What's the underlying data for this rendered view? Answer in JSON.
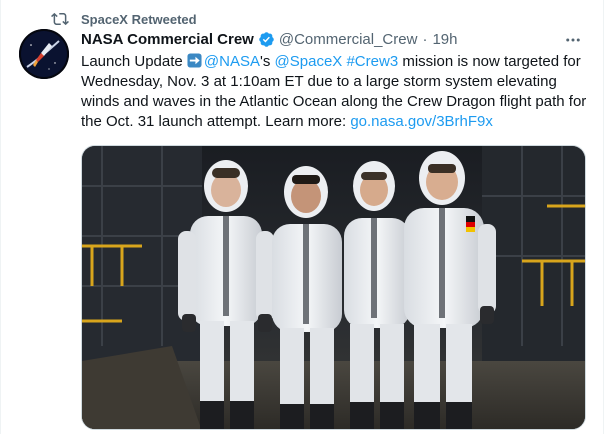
{
  "retweet": {
    "label": "SpaceX Retweeted",
    "icon": "retweet-icon"
  },
  "tweet": {
    "author_name": "NASA Commercial Crew",
    "handle": "@Commercial_Crew",
    "separator": "·",
    "time": "19h",
    "verified": true,
    "text": {
      "part1": "Launch Update ",
      "mention1": "@NASA",
      "part2": "'s ",
      "mention2": "@SpaceX",
      "space": " ",
      "hashtag": "#Crew3",
      "part3": " mission is now targeted for Wednesday, Nov. 3 at 1:10am ET due to a large storm system elevating winds and waves in the Atlantic Ocean along the Crew Dragon flight path for the Oct. 31 launch attempt. Learn more: ",
      "link": "go.nasa.gov/3BrhF9x"
    },
    "media_description_icon": "crew-photo"
  },
  "colors": {
    "accent": "#1d9bf0",
    "text": "#0f1419",
    "muted": "#536471",
    "background": "#ffffff"
  }
}
